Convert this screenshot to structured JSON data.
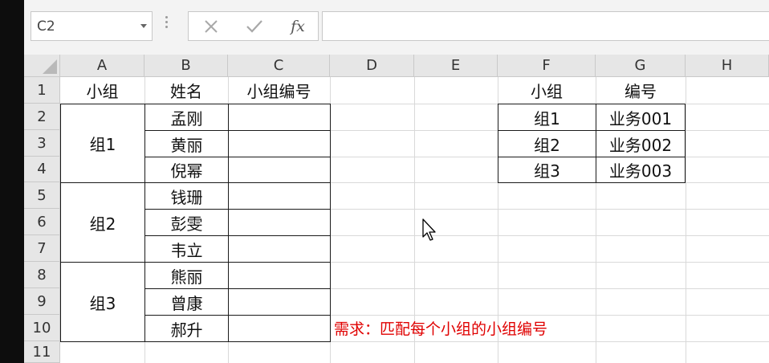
{
  "toolbar": {
    "name_box": "C2",
    "cancel_icon": "close-icon",
    "enter_icon": "check-icon",
    "fx_label": "fx",
    "formula_value": ""
  },
  "columns": [
    "A",
    "B",
    "C",
    "D",
    "E",
    "F",
    "G",
    "H"
  ],
  "rows": [
    "1",
    "2",
    "3",
    "4",
    "5",
    "6",
    "7",
    "8",
    "9",
    "10",
    "11"
  ],
  "table1": {
    "headers": [
      "小组",
      "姓名",
      "小组编号"
    ],
    "groups": [
      {
        "name": "组1",
        "members": [
          "孟刚",
          "黄丽",
          "倪幂"
        ]
      },
      {
        "name": "组2",
        "members": [
          "钱珊",
          "彭雯",
          "韦立"
        ]
      },
      {
        "name": "组3",
        "members": [
          "熊丽",
          "曾康",
          "郝升"
        ]
      }
    ]
  },
  "table2": {
    "headers": [
      "小组",
      "编号"
    ],
    "rows": [
      {
        "group": "组1",
        "code": "业务001"
      },
      {
        "group": "组2",
        "code": "业务002"
      },
      {
        "group": "组3",
        "code": "业务003"
      }
    ]
  },
  "note": "需求：匹配每个小组的小组编号",
  "colors": {
    "note": "#e00000",
    "header_bg": "#e6e6e6"
  }
}
